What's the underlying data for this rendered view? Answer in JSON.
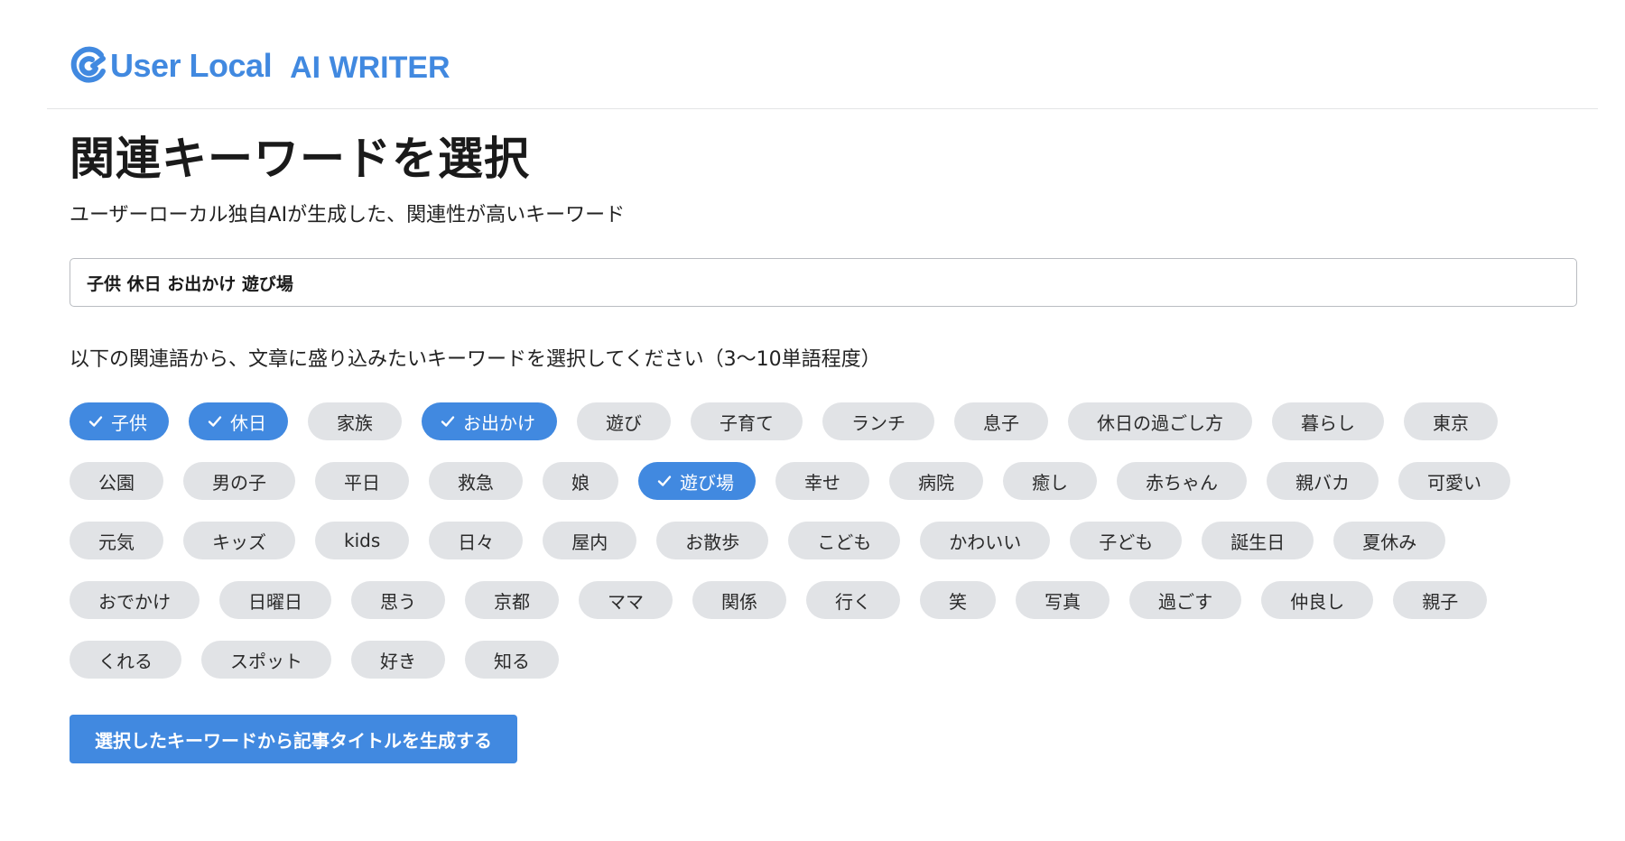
{
  "header": {
    "brand_name": "User Local",
    "product_name": "AI WRITER",
    "brand_color": "#4189e0",
    "logo_icon": "userlocal-logo-icon"
  },
  "page": {
    "title": "関連キーワードを選択",
    "subtitle": "ユーザーローカル独自AIが生成した、関連性が高いキーワード",
    "query_value": "子供 休日 お出かけ 遊び場",
    "instruction": "以下の関連語から、文章に盛り込みたいキーワードを選択してください（3〜10単語程度）"
  },
  "keywords": [
    {
      "label": "子供",
      "selected": true
    },
    {
      "label": "休日",
      "selected": true
    },
    {
      "label": "家族",
      "selected": false
    },
    {
      "label": "お出かけ",
      "selected": true
    },
    {
      "label": "遊び",
      "selected": false
    },
    {
      "label": "子育て",
      "selected": false
    },
    {
      "label": "ランチ",
      "selected": false
    },
    {
      "label": "息子",
      "selected": false
    },
    {
      "label": "休日の過ごし方",
      "selected": false
    },
    {
      "label": "暮らし",
      "selected": false
    },
    {
      "label": "東京",
      "selected": false
    },
    {
      "label": "公園",
      "selected": false
    },
    {
      "label": "男の子",
      "selected": false
    },
    {
      "label": "平日",
      "selected": false
    },
    {
      "label": "救急",
      "selected": false
    },
    {
      "label": "娘",
      "selected": false
    },
    {
      "label": "遊び場",
      "selected": true
    },
    {
      "label": "幸せ",
      "selected": false
    },
    {
      "label": "病院",
      "selected": false
    },
    {
      "label": "癒し",
      "selected": false
    },
    {
      "label": "赤ちゃん",
      "selected": false
    },
    {
      "label": "親バカ",
      "selected": false
    },
    {
      "label": "可愛い",
      "selected": false
    },
    {
      "label": "元気",
      "selected": false
    },
    {
      "label": "キッズ",
      "selected": false
    },
    {
      "label": "kids",
      "selected": false
    },
    {
      "label": "日々",
      "selected": false
    },
    {
      "label": "屋内",
      "selected": false
    },
    {
      "label": "お散歩",
      "selected": false
    },
    {
      "label": "こども",
      "selected": false
    },
    {
      "label": "かわいい",
      "selected": false
    },
    {
      "label": "子ども",
      "selected": false
    },
    {
      "label": "誕生日",
      "selected": false
    },
    {
      "label": "夏休み",
      "selected": false
    },
    {
      "label": "おでかけ",
      "selected": false
    },
    {
      "label": "日曜日",
      "selected": false
    },
    {
      "label": "思う",
      "selected": false
    },
    {
      "label": "京都",
      "selected": false
    },
    {
      "label": "ママ",
      "selected": false
    },
    {
      "label": "関係",
      "selected": false
    },
    {
      "label": "行く",
      "selected": false
    },
    {
      "label": "笑",
      "selected": false
    },
    {
      "label": "写真",
      "selected": false
    },
    {
      "label": "過ごす",
      "selected": false
    },
    {
      "label": "仲良し",
      "selected": false
    },
    {
      "label": "親子",
      "selected": false
    },
    {
      "label": "くれる",
      "selected": false
    },
    {
      "label": "スポット",
      "selected": false
    },
    {
      "label": "好き",
      "selected": false
    },
    {
      "label": "知る",
      "selected": false
    }
  ],
  "actions": {
    "generate_label": "選択したキーワードから記事タイトルを生成する"
  },
  "colors": {
    "accent": "#4189e0",
    "chip_background": "#e1e3e6"
  }
}
